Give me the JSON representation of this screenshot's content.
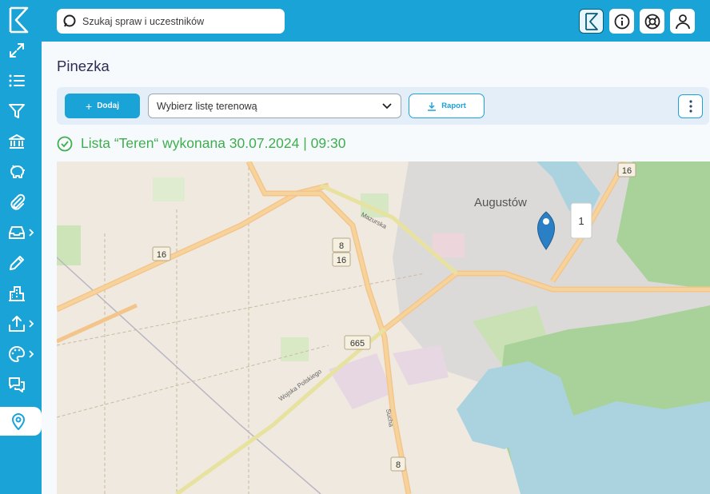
{
  "search": {
    "placeholder": "Szukaj spraw i uczestników"
  },
  "page": {
    "title": "Pinezka"
  },
  "toolbar": {
    "add_label": "Dodaj",
    "select_value": "Wybierz listę terenową",
    "report_label": "Raport"
  },
  "status": {
    "text": "Lista “Teren“ wykonana 30.07.2024 |  09:30"
  },
  "map": {
    "town_label": "Augustów",
    "marker_count": "1",
    "road_labels": [
      "16",
      "8",
      "16",
      "665",
      "16",
      "8"
    ],
    "street_labels": [
      "Mazurska",
      "Wojska Polskiego",
      "Sucha"
    ]
  },
  "sidebar": {
    "items": [
      "expand",
      "list",
      "filter",
      "bank",
      "piggy-bank",
      "attachment",
      "inbox",
      "edit",
      "buildings",
      "upload",
      "palette",
      "chat",
      "location"
    ]
  },
  "colors": {
    "brand": "#1aa3d6",
    "success": "#3fae4f",
    "title": "#2d2d55"
  }
}
